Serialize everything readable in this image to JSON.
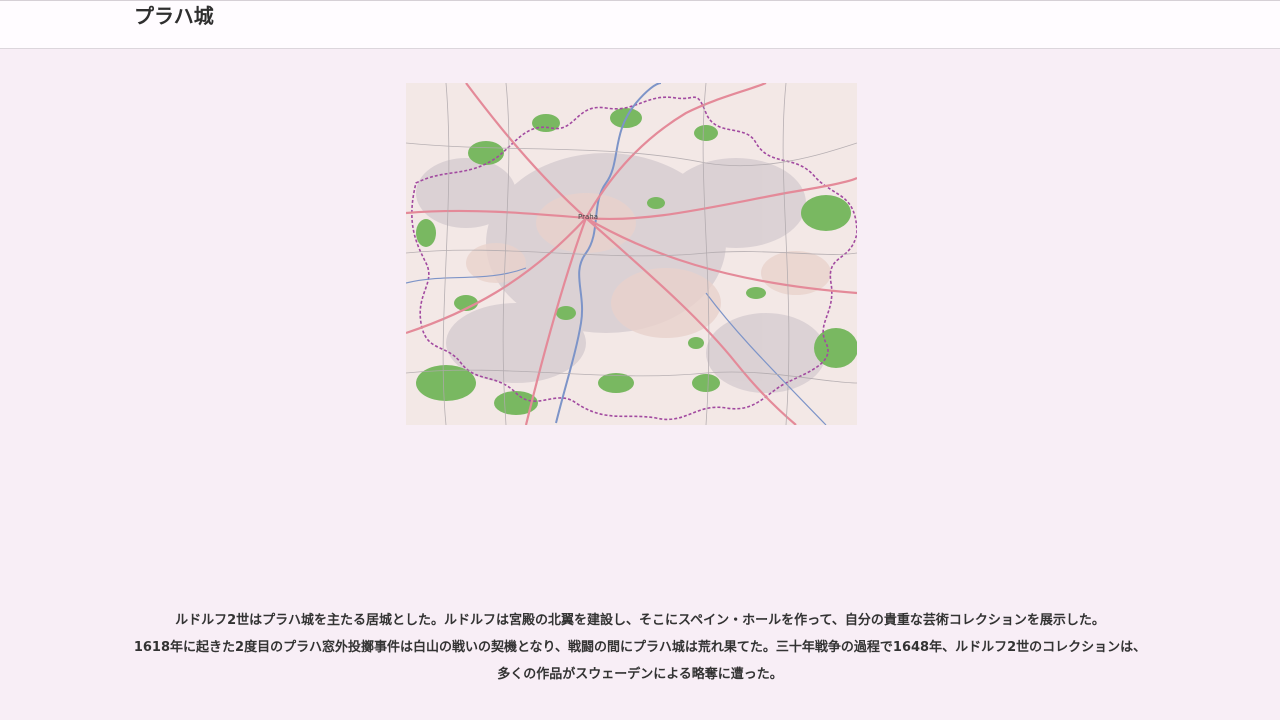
{
  "header": {
    "title": "プラハ城"
  },
  "map": {
    "place_label": "Praha",
    "colors": {
      "land": "#f3e8e6",
      "forest": "#79b861",
      "road": "#e48a99",
      "boundary": "#a24aa0",
      "river": "#7d94c8"
    }
  },
  "caption": {
    "lines": [
      "ルドルフ2世はプラハ城を主たる居城とした。ルドルフは宮殿の北翼を建設し、そこにスペイン・ホールを作って、自分の貴重な芸術コレクションを展示した。",
      "1618年に起きた2度目のプラハ窓外投擲事件は白山の戦いの契機となり、戦闘の間にプラハ城は荒れ果てた。三十年戦争の過程で1648年、ルドルフ2世のコレクションは、",
      "多くの作品がスウェーデンによる略奪に遭った。"
    ]
  }
}
